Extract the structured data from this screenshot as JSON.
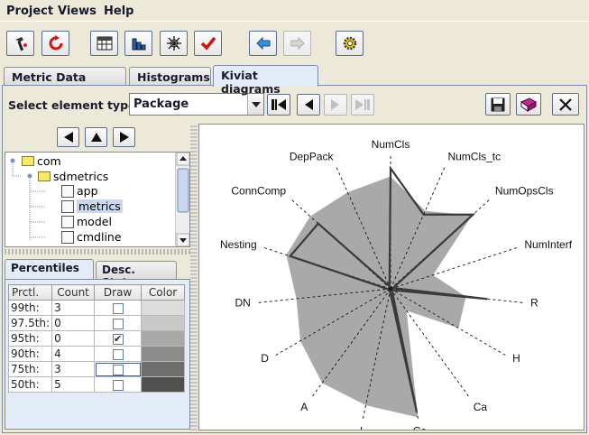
{
  "menu": [
    {
      "label": "Project",
      "accel": "P"
    },
    {
      "label": "Views",
      "accel": "V"
    },
    {
      "label": "Help",
      "accel": "H"
    }
  ],
  "toolbar": [
    {
      "name": "calculate-button",
      "icon": "hammer-icon",
      "disabled": false
    },
    {
      "name": "refresh-button",
      "icon": "refresh-icon",
      "disabled": false
    },
    {
      "name": "table-view-button",
      "icon": "table-icon",
      "disabled": false
    },
    {
      "name": "histogram-view-button",
      "icon": "bar-chart-icon",
      "disabled": false
    },
    {
      "name": "kiviat-view-button",
      "icon": "spider-icon",
      "disabled": false
    },
    {
      "name": "rules-button",
      "icon": "checkmark-icon",
      "disabled": false
    },
    {
      "name": "back-button",
      "icon": "arrow-left-icon",
      "disabled": false
    },
    {
      "name": "forward-button",
      "icon": "arrow-right-icon",
      "disabled": true
    },
    {
      "name": "settings-button",
      "icon": "gear-icon",
      "disabled": false
    }
  ],
  "tabs": [
    {
      "label": "Metric Data Tables",
      "selected": false
    },
    {
      "label": "Histograms",
      "selected": false
    },
    {
      "label": "Kiviat diagrams",
      "selected": true
    }
  ],
  "element_type": {
    "label": "Select element type",
    "value": "Package"
  },
  "tree": [
    {
      "label": "com",
      "kind": "folder",
      "depth": 0,
      "expanded": true
    },
    {
      "label": "sdmetrics",
      "kind": "folder",
      "depth": 1,
      "expanded": true
    },
    {
      "label": "app",
      "kind": "package",
      "depth": 2
    },
    {
      "label": "metrics",
      "kind": "package",
      "depth": 2,
      "selected": true
    },
    {
      "label": "model",
      "kind": "package",
      "depth": 2
    },
    {
      "label": "cmdline",
      "kind": "package",
      "depth": 2
    }
  ],
  "subtabs": [
    {
      "label": "Percentiles",
      "selected": true
    },
    {
      "label": "Desc. Stats.",
      "selected": false
    }
  ],
  "percentile_table": {
    "headers": [
      "Prctl.",
      "Count",
      "Draw",
      "Color"
    ],
    "rows": [
      {
        "prctl": "99th:",
        "count": "3",
        "draw": false,
        "color": "#dcdcdc"
      },
      {
        "prctl": "97.5th:",
        "count": "0",
        "draw": false,
        "color": "#c8c8c8"
      },
      {
        "prctl": "95th:",
        "count": "0",
        "draw": true,
        "color": "#a9a9a9"
      },
      {
        "prctl": "90th:",
        "count": "4",
        "draw": false,
        "color": "#8c8c8c"
      },
      {
        "prctl": "75th:",
        "count": "3",
        "draw": false,
        "color": "#6e6e6e"
      },
      {
        "prctl": "50th:",
        "count": "5",
        "draw": false,
        "color": "#505050"
      }
    ],
    "checkmark": "✔"
  },
  "chart_data": {
    "type": "radar",
    "axes": [
      "NumCls",
      "NumCls_tc",
      "NumOpsCls",
      "NumInterf",
      "R",
      "H",
      "Ca",
      "Ce",
      "I",
      "A",
      "D",
      "DN",
      "Nesting",
      "ConnComp",
      "DepPack"
    ],
    "series": [
      {
        "values": [
          0.83,
          0.63,
          0.81,
          0.33,
          0.56,
          0.58,
          0.2,
          0.97,
          0.88,
          0.86,
          0.77,
          0.7,
          0.81,
          0.8,
          0.78
        ],
        "fill": "#a9a9a9"
      },
      {
        "values": [
          0.89,
          0.6,
          0.82,
          0.02,
          0.72,
          0.02,
          0.02,
          0.93,
          0.02,
          0.02,
          0.02,
          0.02,
          0.78,
          0.72,
          0.02
        ],
        "stroke": "#3a3a3a"
      }
    ]
  },
  "colors": {
    "accent": "#7a8aa8",
    "tab_selected": "#e4ecf7",
    "tree_selected": "#c9d8f0"
  }
}
